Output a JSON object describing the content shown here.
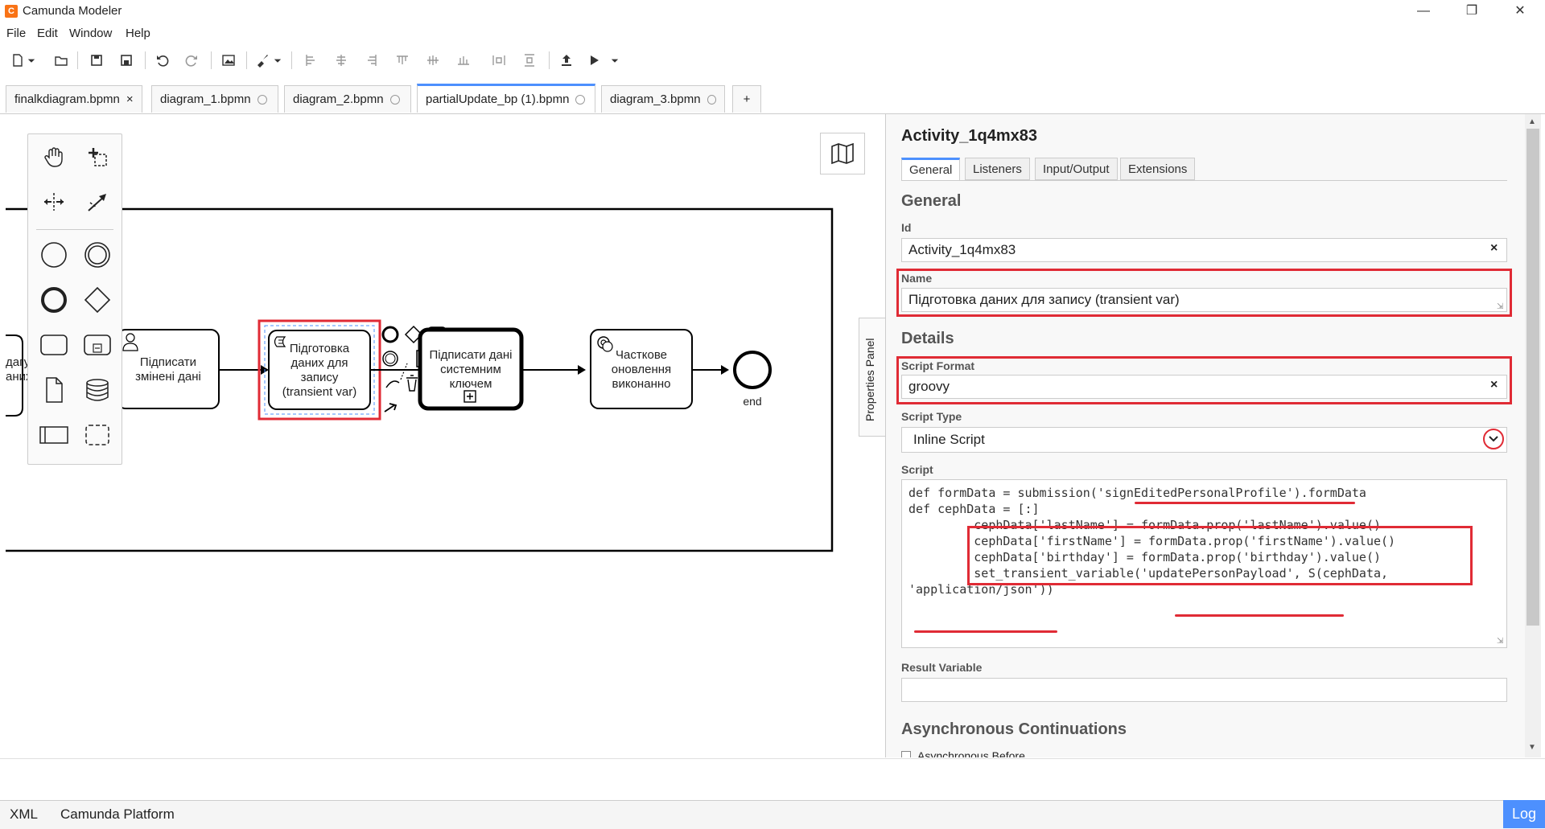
{
  "app": {
    "title": "Camunda Modeler"
  },
  "menu": [
    "File",
    "Edit",
    "Window",
    "Help"
  ],
  "tabs": [
    {
      "label": "finalkdiagram.bpmn",
      "marker": "×"
    },
    {
      "label": "diagram_1.bpmn"
    },
    {
      "label": "diagram_2.bpmn"
    },
    {
      "label": "partialUpdate_bp (1).bpmn"
    },
    {
      "label": "diagram_3.bpmn"
    },
    {
      "label": "+"
    }
  ],
  "diagram": {
    "left_partial_text_1": "дагу",
    "left_partial_text_2": "аних",
    "user_task": "Підписати змінені дані",
    "script_task": "Підготовка даних для запису (transient var)",
    "subprocess": "Підписати дані системним ключем",
    "service_task": "Часткове оновлення виконанно",
    "end_event": "end"
  },
  "properties_toggle": "Properties Panel",
  "panel": {
    "title": "Activity_1q4mx83",
    "tabs": [
      "General",
      "Listeners",
      "Input/Output",
      "Extensions"
    ],
    "section_general": "General",
    "id_label": "Id",
    "id_value": "Activity_1q4mx83",
    "name_label": "Name",
    "name_value": "Підготовка даних для запису (transient var)",
    "section_details": "Details",
    "script_format_label": "Script Format",
    "script_format_value": "groovy",
    "script_type_label": "Script Type",
    "script_type_value": "Inline Script",
    "script_label": "Script",
    "script_lines": [
      "def formData = submission('signEditedPersonalProfile').formData",
      "def cephData = [:]",
      "",
      "         cephData['lastName'] = formData.prop('lastName').value()",
      "         cephData['firstName'] = formData.prop('firstName').value()",
      "         cephData['birthday'] = formData.prop('birthday').value()",
      "",
      "         set_transient_variable('updatePersonPayload', S(cephData,",
      "'application/json'))"
    ],
    "result_variable_label": "Result Variable",
    "result_variable_value": "",
    "section_async": "Asynchronous Continuations",
    "async_before_label": "Asynchronous Before",
    "clear_symbol": "×"
  },
  "status": {
    "xml": "XML",
    "platform": "Camunda Platform",
    "log": "Log"
  },
  "colors": {
    "accent": "#4d90fe",
    "highlight": "#e02b35"
  }
}
